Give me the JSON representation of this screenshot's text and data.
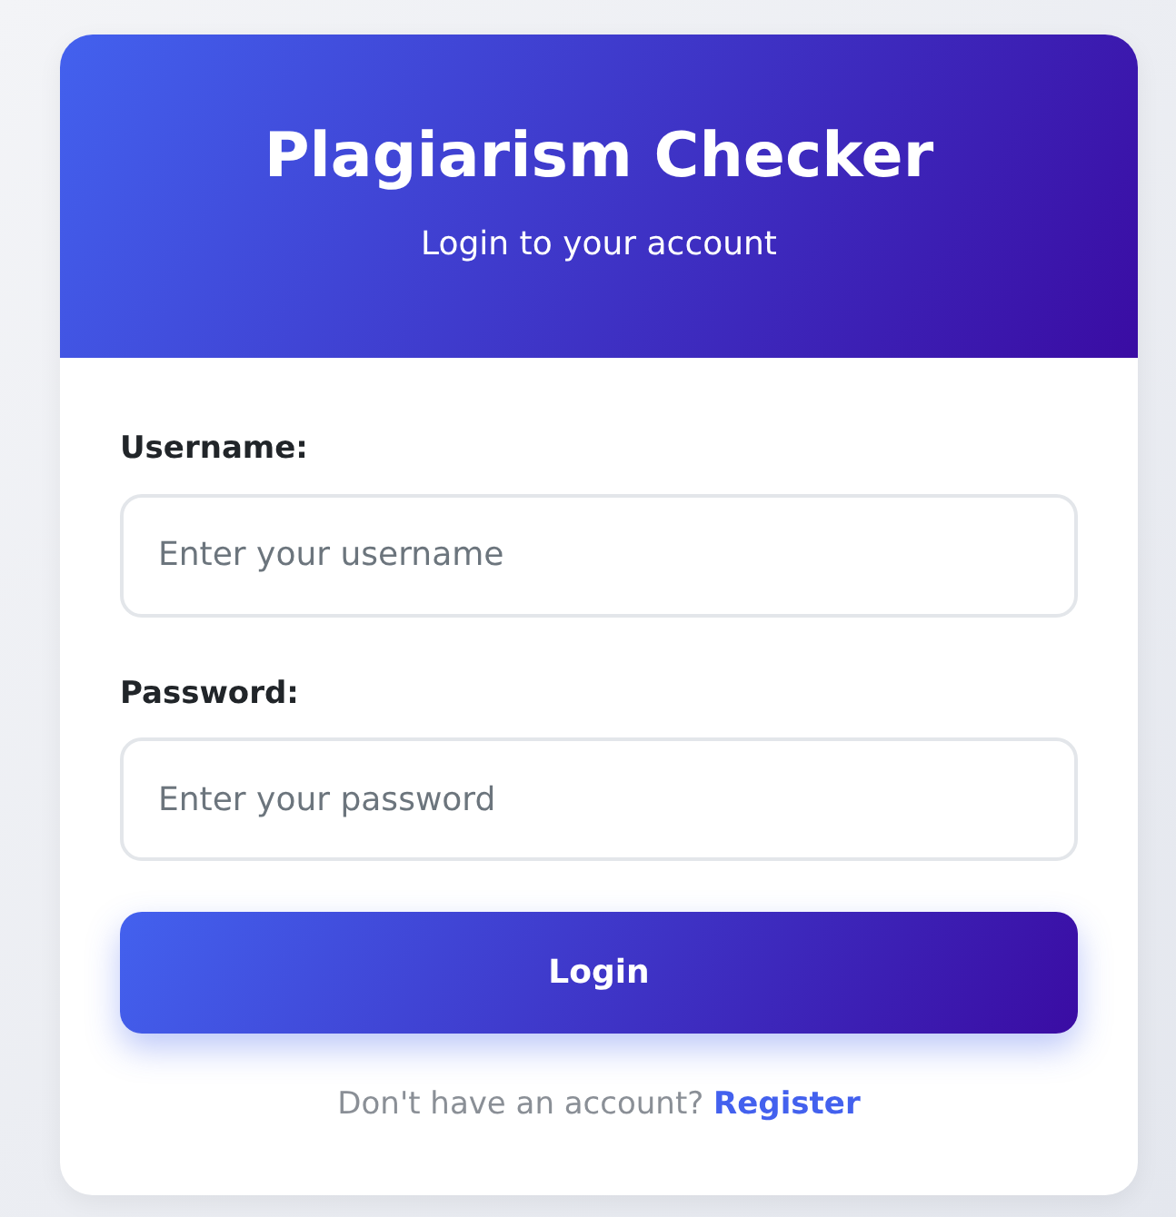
{
  "header": {
    "title": "Plagiarism Checker",
    "subtitle": "Login to your account"
  },
  "fields": [
    {
      "label": "Username:",
      "placeholder": "Enter your username"
    },
    {
      "label": "Password:",
      "placeholder": "Enter your password"
    }
  ],
  "submit_button": "Login",
  "footer": {
    "text": "Don't have an account?",
    "link": "Register"
  }
}
